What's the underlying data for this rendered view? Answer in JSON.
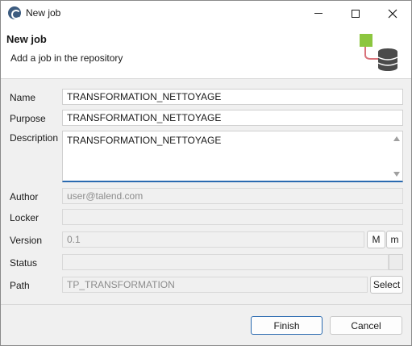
{
  "window": {
    "title": "New job"
  },
  "header": {
    "title": "New job",
    "subtitle": "Add a job in the repository"
  },
  "form": {
    "name": {
      "label": "Name",
      "value": "TRANSFORMATION_NETTOYAGE"
    },
    "purpose": {
      "label": "Purpose",
      "value": "TRANSFORMATION_NETTOYAGE"
    },
    "description": {
      "label": "Description",
      "value": "TRANSFORMATION_NETTOYAGE"
    },
    "author": {
      "label": "Author",
      "value": "user@talend.com"
    },
    "locker": {
      "label": "Locker",
      "value": ""
    },
    "version": {
      "label": "Version",
      "value": "0.1",
      "major_label": "M",
      "minor_label": "m"
    },
    "status": {
      "label": "Status",
      "value": ""
    },
    "path": {
      "label": "Path",
      "value": "TP_TRANSFORMATION",
      "select_label": "Select"
    }
  },
  "buttons": {
    "finish": "Finish",
    "cancel": "Cancel"
  },
  "icons": {
    "app": "talend-studio-icon",
    "minimize": "minimize-icon",
    "maximize": "maximize-icon",
    "close": "close-icon",
    "header": "job-database-icon"
  },
  "colors": {
    "accent": "#2a6ab0",
    "icon_green": "#8cc63f",
    "icon_db": "#4a4a4a",
    "icon_link": "#d9727a"
  }
}
